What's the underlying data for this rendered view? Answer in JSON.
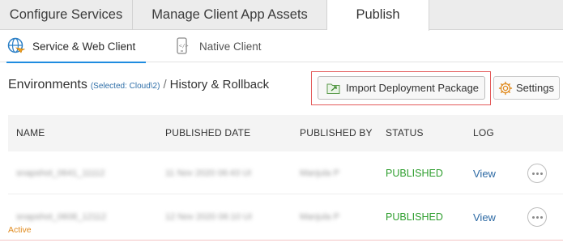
{
  "top_tabs": [
    {
      "label": "Configure Services"
    },
    {
      "label": "Manage Client App Assets"
    },
    {
      "label": "Publish"
    }
  ],
  "sub_tabs": [
    {
      "label": "Service & Web Client",
      "icon": "globe-icon"
    },
    {
      "label": "Native Client",
      "icon": "mobile-code-icon"
    }
  ],
  "breadcrumb": {
    "environments": "Environments",
    "selected": "(Selected: Cloud\\2)",
    "separator": "/",
    "history": "History & Rollback"
  },
  "toolbar": {
    "import_label": "Import Deployment Package",
    "settings_label": "Settings"
  },
  "table": {
    "headers": [
      "NAME",
      "PUBLISHED DATE",
      "PUBLISHED BY",
      "STATUS",
      "LOG"
    ],
    "rows": [
      {
        "name": "snapshot_0641_11112",
        "date": "11 Nov 2020 06:43 UI",
        "by": "Manjula P",
        "status": "PUBLISHED",
        "log": "View"
      },
      {
        "name": "snapshot_0608_12112",
        "date": "12 Nov 2020 06:10 UI",
        "by": "Manjula P",
        "status": "PUBLISHED",
        "log": "View"
      }
    ],
    "active_label": "Active"
  },
  "colors": {
    "accent": "#1f8ce0",
    "status_published": "#2e9e2e",
    "highlight_border": "#e35a5a",
    "active": "#e08a1e"
  }
}
